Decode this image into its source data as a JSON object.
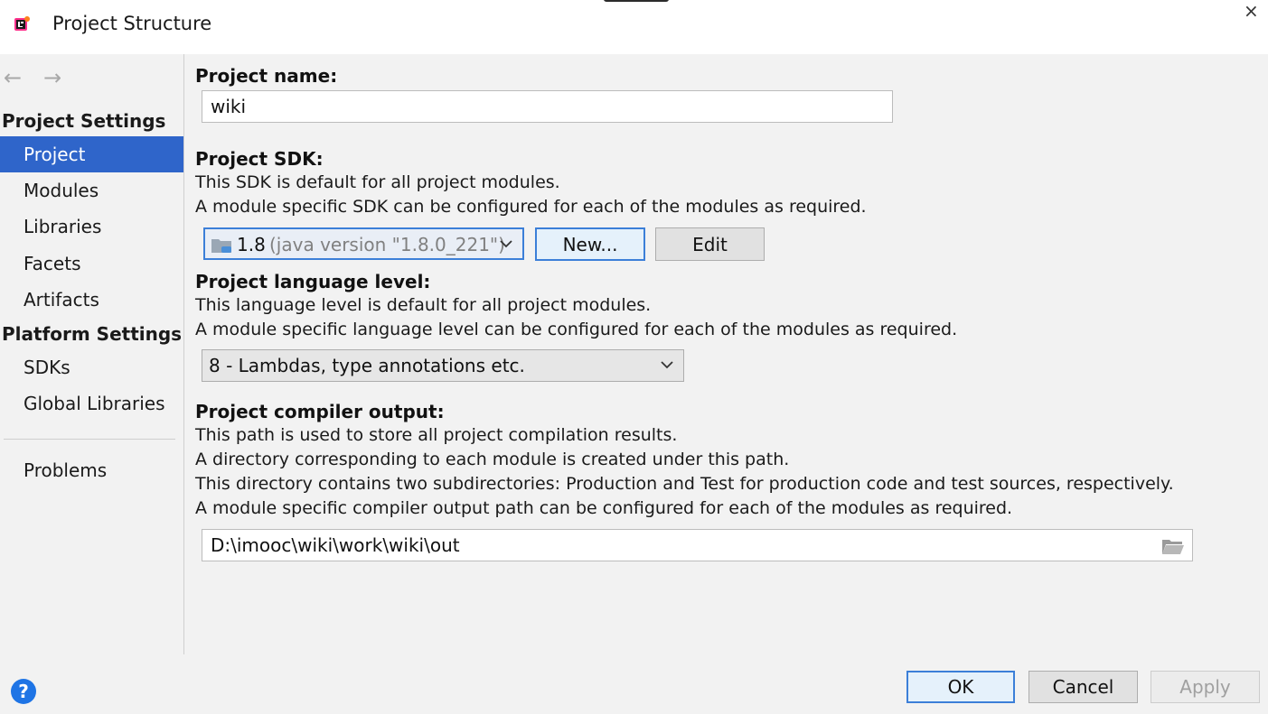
{
  "window": {
    "title": "Project Structure",
    "close_glyph": "×"
  },
  "nav": {
    "back_glyph": "←",
    "forward_glyph": "→"
  },
  "sidebar": {
    "project_settings_header": "Project Settings",
    "project_items": [
      {
        "label": "Project",
        "selected": true
      },
      {
        "label": "Modules"
      },
      {
        "label": "Libraries"
      },
      {
        "label": "Facets"
      },
      {
        "label": "Artifacts"
      }
    ],
    "platform_settings_header": "Platform Settings",
    "platform_items": [
      {
        "label": "SDKs"
      },
      {
        "label": "Global Libraries"
      }
    ],
    "problems_label": "Problems"
  },
  "project": {
    "name_label": "Project name:",
    "name_value": "wiki",
    "sdk_label": "Project SDK:",
    "sdk_desc1": "This SDK is default for all project modules.",
    "sdk_desc2": "A module specific SDK can be configured for each of the modules as required.",
    "sdk_value": "1.8",
    "sdk_detail": "(java version \"1.8.0_221\")",
    "sdk_new_button": "New...",
    "sdk_edit_button": "Edit",
    "lang_label": "Project language level:",
    "lang_desc1": "This language level is default for all project modules.",
    "lang_desc2": "A module specific language level can be configured for each of the modules as required.",
    "lang_value": "8 - Lambdas, type annotations etc.",
    "output_label": "Project compiler output:",
    "output_desc1": "This path is used to store all project compilation results.",
    "output_desc2": "A directory corresponding to each module is created under this path.",
    "output_desc3": "This directory contains two subdirectories: Production and Test for production code and test sources, respectively.",
    "output_desc4": "A module specific compiler output path can be configured for each of the modules as required.",
    "output_path": "D:\\imooc\\wiki\\work\\wiki\\out"
  },
  "footer": {
    "help_glyph": "?",
    "ok_label": "OK",
    "cancel_label": "Cancel",
    "apply_label": "Apply"
  },
  "colors": {
    "selection": "#2f65ca",
    "focus_border": "#3c7fd8",
    "help_icon": "#1e74e5"
  },
  "icons": [
    "app-logo-icon",
    "close-icon",
    "back-arrow-icon",
    "forward-arrow-icon",
    "folder-icon",
    "chevron-down-icon",
    "browse-folder-icon",
    "help-icon"
  ]
}
